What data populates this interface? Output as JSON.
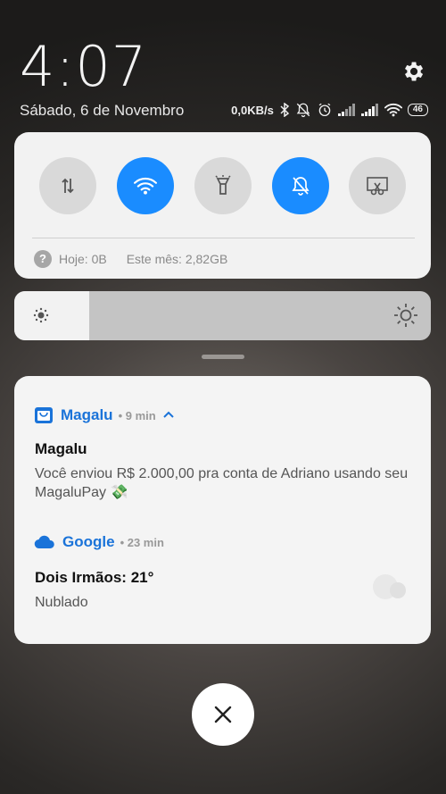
{
  "header": {
    "time": "4:07",
    "date": "Sábado, 6 de Novembro"
  },
  "status": {
    "speed": "0,0KB/s",
    "battery": "46",
    "icons": [
      "bluetooth-icon",
      "alarm-off-icon",
      "alarm-clock-icon",
      "signal-icon",
      "signal-icon",
      "wifi-icon",
      "battery-icon"
    ]
  },
  "quick_settings": {
    "toggles": [
      {
        "name": "mobile-data",
        "icon": "data-arrows-icon",
        "active": false
      },
      {
        "name": "wifi",
        "icon": "wifi-icon",
        "active": true
      },
      {
        "name": "flashlight",
        "icon": "flashlight-icon",
        "active": false
      },
      {
        "name": "silent",
        "icon": "bell-off-icon",
        "active": true
      },
      {
        "name": "screenshot",
        "icon": "scissors-icon",
        "active": false
      }
    ],
    "data_today": "Hoje: 0B",
    "data_month": "Este mês: 2,82GB"
  },
  "brightness": {
    "level": 0.18
  },
  "notifications": [
    {
      "app": "Magalu",
      "time": "9 min",
      "title": "Magalu",
      "body": "Você enviou R$ 2.000,00 pra conta de Adriano usando seu MagaluPay 💸"
    },
    {
      "app": "Google",
      "time": "23 min",
      "title": "Dois Irmãos: 21°",
      "body": "Nublado"
    }
  ],
  "colors": {
    "accent": "#1a8cff",
    "app_name": "#1a73d9",
    "panel": "#f2f2f2",
    "inactive_toggle": "#d9d9d9"
  }
}
